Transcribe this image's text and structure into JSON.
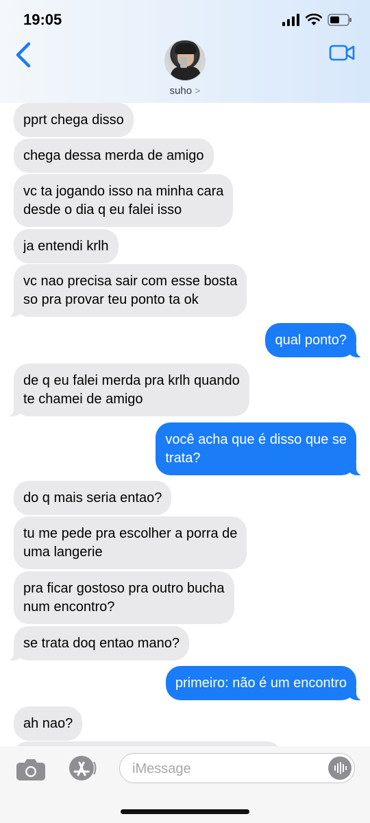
{
  "status_bar": {
    "time": "19:05"
  },
  "header": {
    "contact_name": "suho",
    "chevron": ">"
  },
  "icons": {
    "back": "chevron-left-icon",
    "video": "video-camera-icon",
    "camera": "camera-icon",
    "appstore": "app-store-icon",
    "audio": "waveform-icon",
    "accent": "#1a7cf7"
  },
  "messages": [
    {
      "from": "them",
      "text": "pprt chega disso"
    },
    {
      "from": "them",
      "text": "chega dessa merda de amigo"
    },
    {
      "from": "them",
      "lines": [
        "vc ta jogando isso na minha cara",
        "desde o dia q eu falei isso"
      ]
    },
    {
      "from": "them",
      "text": "ja entendi krlh"
    },
    {
      "from": "them",
      "lines": [
        "vc nao precisa sair com esse bosta",
        "so pra provar teu ponto ta ok"
      ]
    },
    {
      "from": "me",
      "text": "qual ponto?"
    },
    {
      "from": "them",
      "lines": [
        "de q eu falei merda pra krlh quando",
        "te chamei de amigo"
      ]
    },
    {
      "from": "me",
      "lines": [
        "você acha que é disso que se",
        "trata?"
      ]
    },
    {
      "from": "them",
      "text": "do q mais seria entao?"
    },
    {
      "from": "them",
      "lines": [
        "tu me pede pra escolher a porra de",
        "uma langerie"
      ]
    },
    {
      "from": "them",
      "lines": [
        "pra ficar gostoso pra outro bucha",
        "num encontro?"
      ]
    },
    {
      "from": "them",
      "text": "se trata doq entao mano?"
    },
    {
      "from": "me",
      "text": "primeiro: não é um encontro"
    },
    {
      "from": "them",
      "text": "ah nao?"
    }
  ],
  "composer": {
    "placeholder": "iMessage"
  }
}
